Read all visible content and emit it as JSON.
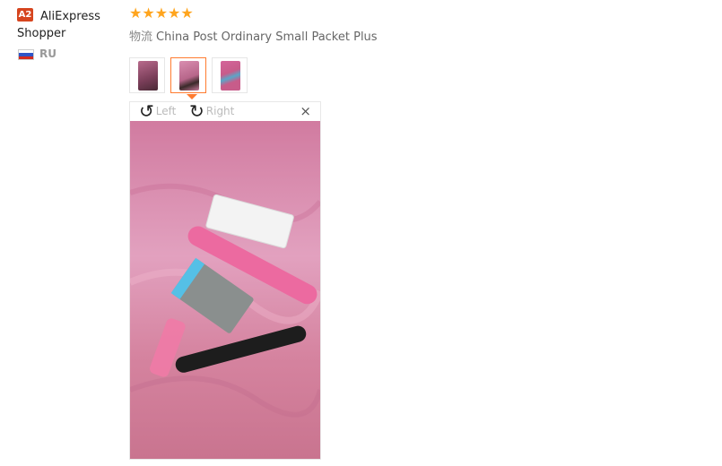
{
  "reviewer": {
    "badge": "A2",
    "name": "AliExpress Shopper",
    "country": "RU"
  },
  "review": {
    "rating": 5,
    "rating_max": 5,
    "shipping_label": "物流",
    "shipping_method": "China Post Ordinary Small Packet Plus"
  },
  "gallery": {
    "thumbnail_count": 3,
    "selected_index": 1
  },
  "viewer": {
    "rotate_left_label": "Left",
    "rotate_right_label": "Right",
    "close_symbol": "×"
  },
  "colors": {
    "accent": "#ff7b2f",
    "star": "#ffa51e",
    "badge": "#d6451f"
  },
  "icons": [
    "star-icon",
    "rotate-left-icon",
    "rotate-right-icon",
    "close-icon",
    "flag-ru-icon"
  ]
}
